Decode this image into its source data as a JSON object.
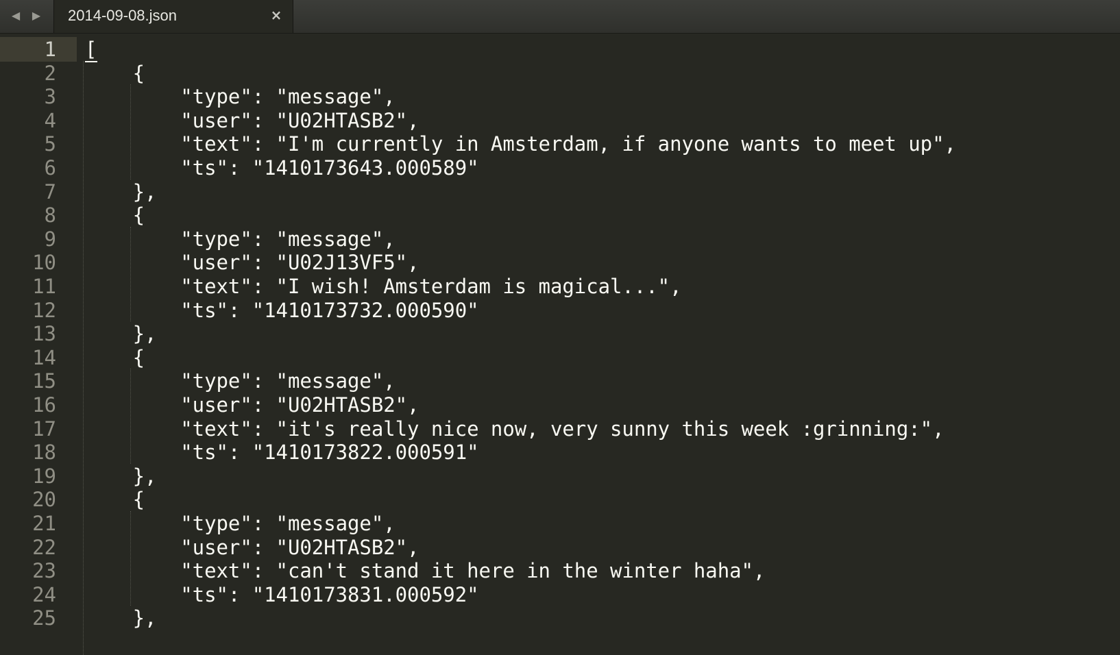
{
  "tab": {
    "title": "2014-09-08.json",
    "close_icon": "×",
    "back_icon": "◀",
    "forward_icon": "▶"
  },
  "editor": {
    "active_line": 1,
    "lines": [
      "[",
      "    {",
      "        \"type\": \"message\",",
      "        \"user\": \"U02HTASB2\",",
      "        \"text\": \"I'm currently in Amsterdam, if anyone wants to meet up\",",
      "        \"ts\": \"1410173643.000589\"",
      "    },",
      "    {",
      "        \"type\": \"message\",",
      "        \"user\": \"U02J13VF5\",",
      "        \"text\": \"I wish! Amsterdam is magical...\",",
      "        \"ts\": \"1410173732.000590\"",
      "    },",
      "    {",
      "        \"type\": \"message\",",
      "        \"user\": \"U02HTASB2\",",
      "        \"text\": \"it's really nice now, very sunny this week :grinning:\",",
      "        \"ts\": \"1410173822.000591\"",
      "    },",
      "    {",
      "        \"type\": \"message\",",
      "        \"user\": \"U02HTASB2\",",
      "        \"text\": \"can't stand it here in the winter haha\",",
      "        \"ts\": \"1410173831.000592\"",
      "    },"
    ]
  },
  "colors": {
    "background": "#272822",
    "foreground": "#f8f8f2",
    "gutter_text": "#908f85",
    "active_line": "#3e3d32"
  }
}
